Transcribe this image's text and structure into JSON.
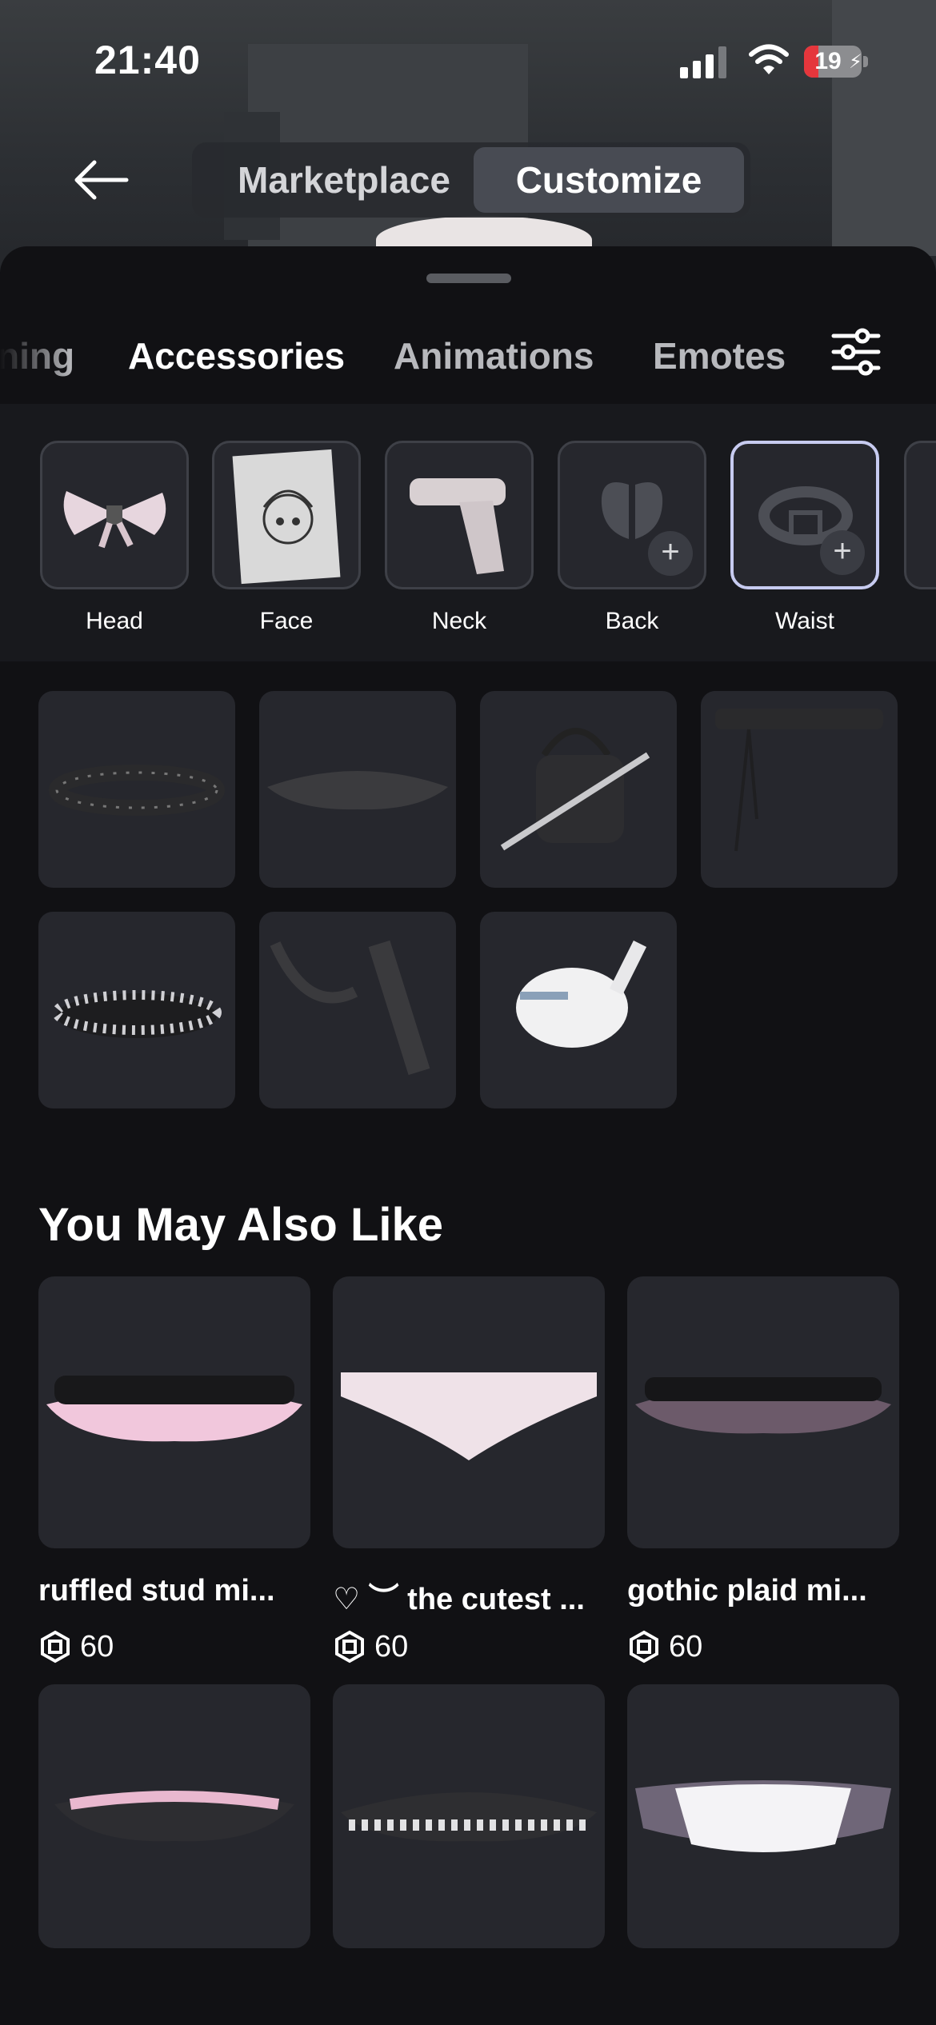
{
  "status": {
    "time": "21:40",
    "battery": "19"
  },
  "nav": {
    "marketplace": "Marketplace",
    "customize": "Customize"
  },
  "tabs": [
    "ning",
    "Accessories",
    "Animations",
    "Emotes"
  ],
  "slots": [
    {
      "label": "Head"
    },
    {
      "label": "Face"
    },
    {
      "label": "Neck"
    },
    {
      "label": "Back",
      "add": "+"
    },
    {
      "label": "Waist",
      "add": "+"
    }
  ],
  "section_title": "You May Also Like",
  "recommended": [
    {
      "name": "ruffled stud mi...",
      "price": "60"
    },
    {
      "name": "♡ ︶ the cutest ...",
      "price": "60"
    },
    {
      "name": "gothic plaid mi...",
      "price": "60"
    }
  ],
  "colors": {
    "accent_selected": "#c7cbf0",
    "background": "#111114",
    "tile": "#26272d"
  }
}
